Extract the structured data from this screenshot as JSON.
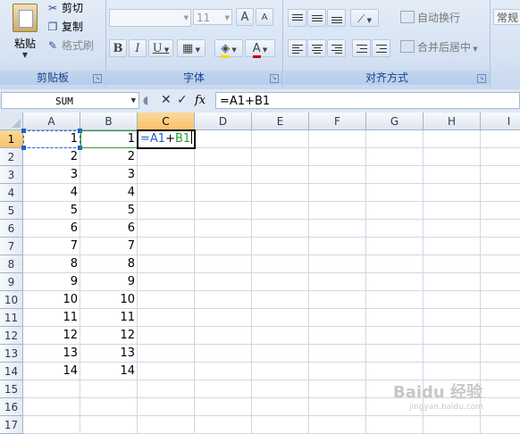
{
  "ribbon": {
    "clipboard": {
      "paste_label": "粘贴",
      "cut_label": "剪切",
      "copy_label": "复制",
      "format_painter_label": "格式刷",
      "group_label": "剪贴板"
    },
    "font": {
      "font_name": "",
      "font_size": "11",
      "grow_label": "A",
      "shrink_label": "A",
      "bold_label": "B",
      "italic_label": "I",
      "underline_label": "U",
      "font_color_label": "A",
      "group_label": "字体"
    },
    "alignment": {
      "wrap_label": "自动换行",
      "merge_label": "合并后居中",
      "group_label": "对齐方式"
    },
    "number": {
      "format_value": "常规"
    }
  },
  "formula_bar": {
    "name_box": "SUM",
    "cancel_icon": "✕",
    "enter_icon": "✓",
    "fx_label": "fx",
    "formula": "=A1+B1"
  },
  "grid": {
    "columns": [
      "A",
      "B",
      "C",
      "D",
      "E",
      "F",
      "G",
      "H",
      "I"
    ],
    "rows": [
      "1",
      "2",
      "3",
      "4",
      "5",
      "6",
      "7",
      "8",
      "9",
      "10",
      "11",
      "12",
      "13",
      "14",
      "15",
      "16",
      "17"
    ],
    "col_a": [
      "1",
      "2",
      "3",
      "4",
      "5",
      "6",
      "7",
      "8",
      "9",
      "10",
      "11",
      "12",
      "13",
      "14"
    ],
    "col_b": [
      "1",
      "2",
      "3",
      "4",
      "5",
      "6",
      "7",
      "8",
      "9",
      "10",
      "11",
      "12",
      "13",
      "14"
    ],
    "active_cell_formula": {
      "eq": "=",
      "ref_a": "A1",
      "plus": "+",
      "ref_b": "B1"
    },
    "ref_a_color": "#1f5fd4",
    "ref_b_color": "#2f9a2f"
  },
  "watermark": {
    "brand": "Baidu 经验",
    "url": "jingyan.baidu.com"
  }
}
